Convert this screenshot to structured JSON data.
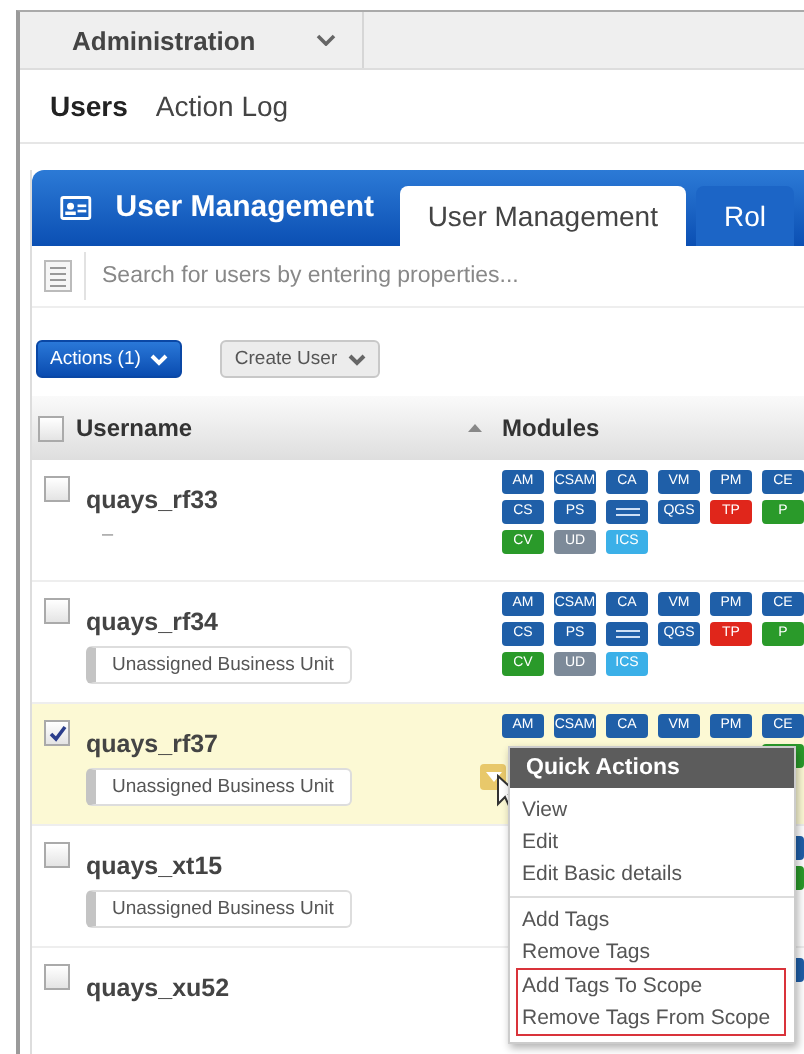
{
  "top_bar": {
    "menu": "Administration"
  },
  "subnav": [
    {
      "label": "Users",
      "selected": true
    },
    {
      "label": "Action Log",
      "selected": false
    }
  ],
  "panel": {
    "title": "User Management",
    "tabs": [
      {
        "label": "User Management",
        "selected": true
      },
      {
        "label": "Rol",
        "selected": false
      }
    ]
  },
  "search": {
    "placeholder": "Search for users by entering properties..."
  },
  "toolbar": {
    "actions": "Actions (1)",
    "create": "Create User"
  },
  "table": {
    "all_checked": false,
    "columns": [
      "Username",
      "Modules"
    ],
    "rows": [
      {
        "username": "quays_rf33",
        "selected": false,
        "note": "–",
        "modules": [
          [
            {
              "text": "AM",
              "color": "#1f5fa8"
            },
            {
              "text": "CSAM",
              "color": "#1f5fa8"
            },
            {
              "text": "CA",
              "color": "#1f5fa8"
            },
            {
              "text": "VM",
              "color": "#1f5fa8"
            },
            {
              "text": "PM",
              "color": "#1f5fa8"
            },
            {
              "kind": "cut",
              "text": "CE",
              "color": "#1f5fa8"
            }
          ],
          [
            {
              "text": "CS",
              "color": "#1f5fa8"
            },
            {
              "text": "PS",
              "color": "#1f5fa8"
            },
            {
              "kind": "tiny",
              "color": "#1f5fa8"
            },
            {
              "text": "QGS",
              "color": "#1f5fa8"
            },
            {
              "text": "TP",
              "color": "#e0261b"
            },
            {
              "kind": "cut",
              "text": "P",
              "color": "#2a9a2a"
            }
          ],
          [
            {
              "text": "CV",
              "color": "#2a9a2a"
            },
            {
              "text": "UD",
              "color": "#7d8a99"
            },
            {
              "text": "ICS",
              "color": "#3bb0e8"
            }
          ]
        ]
      },
      {
        "username": "quays_rf34",
        "selected": false,
        "unit": {
          "kind": "pill",
          "text": "Unassigned Business Unit"
        },
        "modules": [
          [
            {
              "text": "AM",
              "color": "#1f5fa8"
            },
            {
              "text": "CSAM",
              "color": "#1f5fa8"
            },
            {
              "text": "CA",
              "color": "#1f5fa8"
            },
            {
              "text": "VM",
              "color": "#1f5fa8"
            },
            {
              "text": "PM",
              "color": "#1f5fa8"
            },
            {
              "kind": "cut",
              "text": "CE",
              "color": "#1f5fa8"
            }
          ],
          [
            {
              "text": "CS",
              "color": "#1f5fa8"
            },
            {
              "text": "PS",
              "color": "#1f5fa8"
            },
            {
              "kind": "tiny",
              "color": "#1f5fa8"
            },
            {
              "text": "QGS",
              "color": "#1f5fa8"
            },
            {
              "text": "TP",
              "color": "#e0261b"
            },
            {
              "kind": "cut",
              "text": "P",
              "color": "#2a9a2a"
            }
          ],
          [
            {
              "text": "CV",
              "color": "#2a9a2a"
            },
            {
              "text": "UD",
              "color": "#7d8a99"
            },
            {
              "text": "ICS",
              "color": "#3bb0e8"
            }
          ]
        ]
      },
      {
        "username": "quays_rf37",
        "selected": true,
        "unit": {
          "kind": "pill",
          "text": "Unassigned Business Unit"
        },
        "modules": [
          [
            {
              "text": "AM",
              "color": "#1f5fa8"
            },
            {
              "text": "CSAM",
              "color": "#1f5fa8"
            },
            {
              "text": "CA",
              "color": "#1f5fa8"
            },
            {
              "text": "VM",
              "color": "#1f5fa8"
            },
            {
              "text": "PM",
              "color": "#1f5fa8"
            },
            {
              "kind": "cut",
              "text": "CE",
              "color": "#1f5fa8"
            }
          ],
          [
            {
              "kind": "cut",
              "color": "#2a9a2a"
            }
          ]
        ]
      },
      {
        "username": "quays_xt15",
        "selected": false,
        "unit": {
          "kind": "pill",
          "text": "Unassigned Business Unit"
        },
        "modules": [
          [
            {
              "kind": "cut",
              "color": "#1f5fa8"
            }
          ],
          [
            {
              "kind": "cut",
              "color": "#2a9a2a"
            }
          ]
        ]
      },
      {
        "username": "quays_xu52",
        "selected": false,
        "modules": [
          [
            {
              "kind": "cut",
              "color": "#1f5fa8"
            }
          ]
        ]
      }
    ]
  },
  "quick_actions": {
    "title": "Quick Actions",
    "groups": [
      {
        "highlighted": false,
        "items": [
          "View",
          "Edit",
          "Edit Basic details"
        ]
      },
      {
        "highlighted": false,
        "items": [
          "Add Tags",
          "Remove Tags"
        ]
      },
      {
        "highlighted": true,
        "items": [
          "Add Tags To Scope",
          "Remove Tags From Scope"
        ]
      }
    ]
  }
}
